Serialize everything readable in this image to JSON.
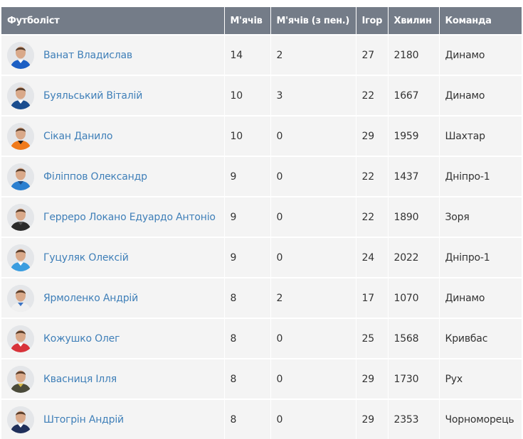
{
  "table": {
    "headers": [
      "Футболіст",
      "М'ячів",
      "М'ячів (з пен.)",
      "Ігор",
      "Хвилин",
      "Команда"
    ],
    "rows": [
      {
        "player": "Ванат Владислав",
        "goals": "14",
        "pen_goals": "2",
        "games": "27",
        "minutes": "2180",
        "team": "Динамо",
        "kit_color": "#1c5fc4",
        "kit_accent": "#ffffff"
      },
      {
        "player": "Буяльський Віталій",
        "goals": "10",
        "pen_goals": "3",
        "games": "22",
        "minutes": "1667",
        "team": "Динамо",
        "kit_color": "#1a4d8f",
        "kit_accent": "#ffffff"
      },
      {
        "player": "Сікан Данило",
        "goals": "10",
        "pen_goals": "0",
        "games": "29",
        "minutes": "1959",
        "team": "Шахтар",
        "kit_color": "#f07a1a",
        "kit_accent": "#222222"
      },
      {
        "player": "Філіппов Олександр",
        "goals": "9",
        "pen_goals": "0",
        "games": "22",
        "minutes": "1437",
        "team": "Дніпро-1",
        "kit_color": "#2a7fd0",
        "kit_accent": "#1d4f8a"
      },
      {
        "player": "Герреро Локано Едуардо Антоніо",
        "goals": "9",
        "pen_goals": "0",
        "games": "22",
        "minutes": "1890",
        "team": "Зоря",
        "kit_color": "#2b2b2b",
        "kit_accent": "#555555"
      },
      {
        "player": "Гуцуляк Олексій",
        "goals": "9",
        "pen_goals": "0",
        "games": "24",
        "minutes": "2022",
        "team": "Дніпро-1",
        "kit_color": "#3a9de0",
        "kit_accent": "#ffffff"
      },
      {
        "player": "Ярмоленко Андрій",
        "goals": "8",
        "pen_goals": "2",
        "games": "17",
        "minutes": "1070",
        "team": "Динамо",
        "kit_color": "#f0f0f0",
        "kit_accent": "#3b74c4"
      },
      {
        "player": "Кожушко Олег",
        "goals": "8",
        "pen_goals": "0",
        "games": "25",
        "minutes": "1568",
        "team": "Кривбас",
        "kit_color": "#d8333a",
        "kit_accent": "#ffffff"
      },
      {
        "player": "Квасниця Ілля",
        "goals": "8",
        "pen_goals": "0",
        "games": "29",
        "minutes": "1730",
        "team": "Рух",
        "kit_color": "#4a4a3a",
        "kit_accent": "#d4b84a"
      },
      {
        "player": "Штогрін Андрій",
        "goals": "8",
        "pen_goals": "0",
        "games": "29",
        "minutes": "2353",
        "team": "Чорноморець",
        "kit_color": "#1f2f5a",
        "kit_accent": "#ffffff"
      }
    ]
  }
}
